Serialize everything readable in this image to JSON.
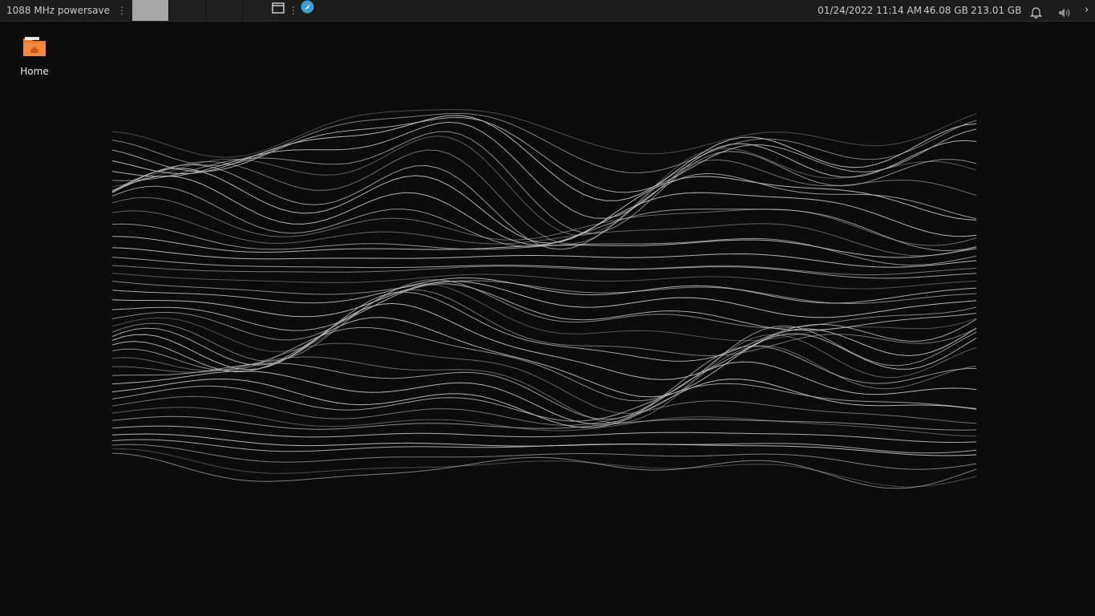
{
  "panel": {
    "cpu_status": "1088 MHz powersave",
    "workspaces": [
      {
        "name": "workspace-1",
        "active": true
      },
      {
        "name": "workspace-2",
        "active": false
      },
      {
        "name": "workspace-3",
        "active": false
      },
      {
        "name": "workspace-4",
        "active": false
      }
    ],
    "clock": "01/24/2022 11:14 AM",
    "disk_usage_1": "46.08 GB",
    "disk_usage_2": "213.01 GB",
    "icons": {
      "window_list": "window-icon",
      "launcher": "app-launcher-icon",
      "notifications": "bell-icon",
      "volume": "volume-icon",
      "overflow": "chevron-right-icon"
    },
    "accent": "#3a9fd8"
  },
  "desktop": {
    "icons": [
      {
        "label": "Home",
        "icon": "home-folder-icon",
        "color": "#f07a2e"
      }
    ]
  },
  "wallpaper": {
    "type": "wireframe-terrain",
    "line_color": "#bdbdbd",
    "background": "#0b0b0b"
  }
}
